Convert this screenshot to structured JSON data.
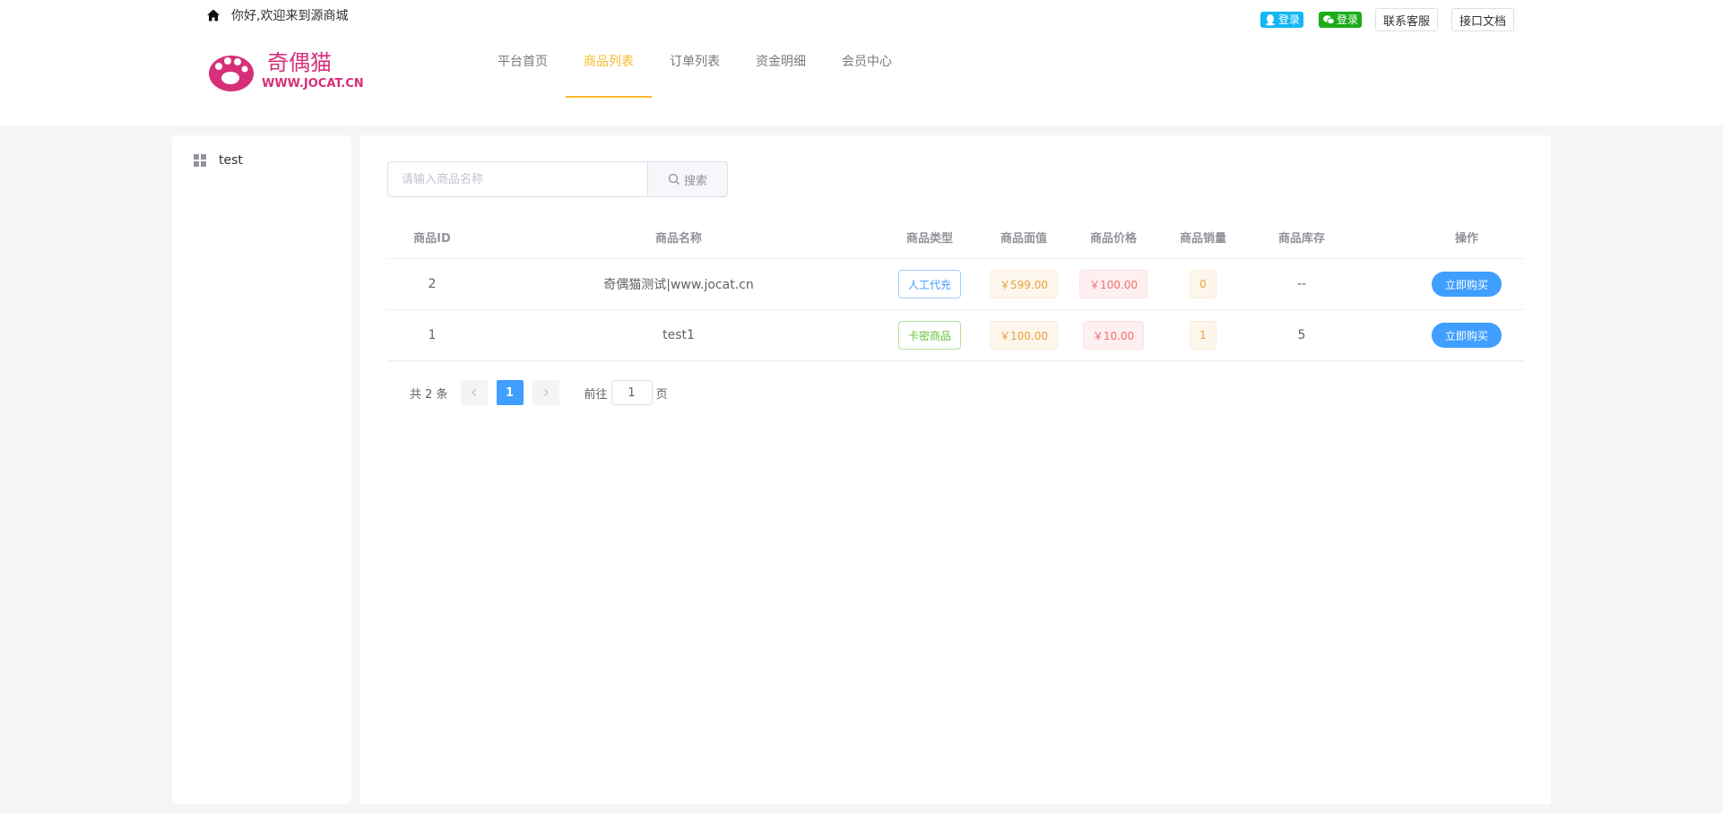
{
  "header": {
    "welcome": "你好,欢迎来到源商城",
    "qq_login": "登录",
    "wechat_login": "登录",
    "contact_service": "联系客服",
    "api_docs": "接口文档",
    "nav": [
      {
        "label": "平台首页"
      },
      {
        "label": "商品列表"
      },
      {
        "label": "订单列表"
      },
      {
        "label": "资金明细"
      },
      {
        "label": "会员中心"
      }
    ],
    "active_nav": "商品列表",
    "accent_color": "#f7ba2a"
  },
  "logo": {
    "text_cn": "奇偶猫",
    "text_en": "WWW.JOCAT.CN",
    "color": "#d6307a"
  },
  "sidebar": {
    "items": [
      {
        "label": "test",
        "icon": "grid-icon"
      }
    ]
  },
  "search": {
    "placeholder": "请输入商品名称",
    "button_label": "搜索"
  },
  "table": {
    "headers": {
      "id": "商品ID",
      "name": "商品名称",
      "type": "商品类型",
      "face_value": "商品面值",
      "price": "商品价格",
      "sales": "商品销量",
      "stock": "商品库存",
      "op": "操作"
    },
    "rows": [
      {
        "id": "2",
        "name": "奇偶猫测试|www.jocat.cn",
        "type": "人工代充",
        "face_value": "￥599.00",
        "price": "￥100.00",
        "sales": "0",
        "stock": "--",
        "action": "立即购买"
      },
      {
        "id": "1",
        "name": "test1",
        "type": "卡密商品",
        "face_value": "￥100.00",
        "price": "￥10.00",
        "sales": "1",
        "stock": "5",
        "action": "立即购买"
      }
    ]
  },
  "pagination": {
    "total": "共 2 条",
    "current": "1",
    "goto_label": "前往",
    "goto_value": "1",
    "page_suffix": "页"
  }
}
